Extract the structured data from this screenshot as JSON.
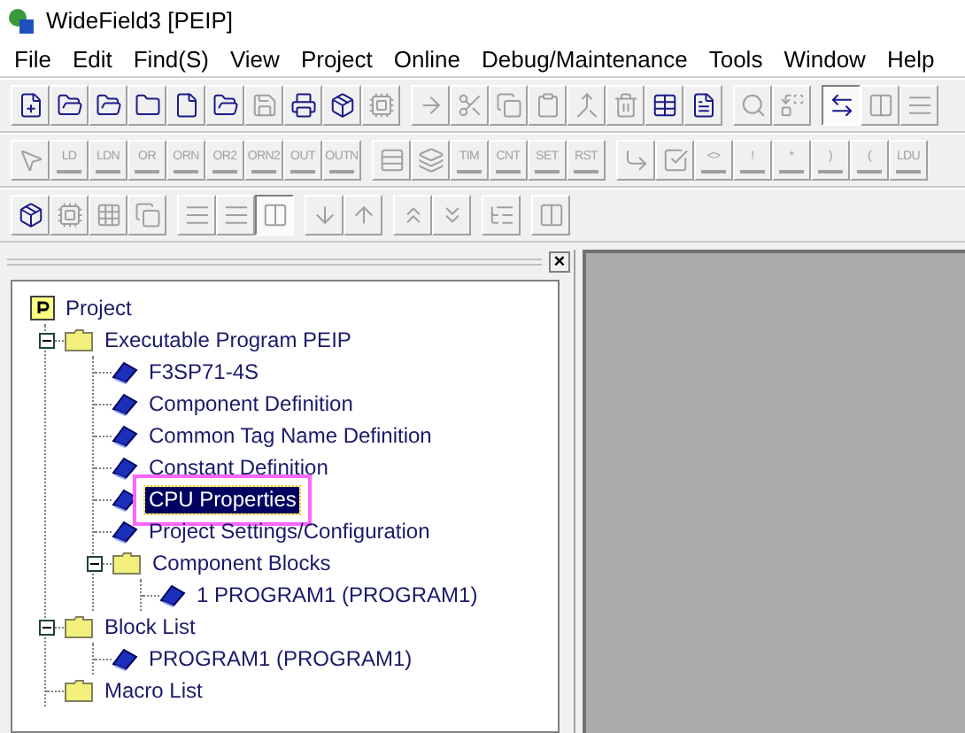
{
  "window": {
    "title": "WideField3 [PEIP]"
  },
  "menu": [
    "File",
    "Edit",
    "Find(S)",
    "View",
    "Project",
    "Online",
    "Debug/Maintenance",
    "Tools",
    "Window",
    "Help"
  ],
  "toolbars": [
    {
      "groups": [
        [
          {
            "kind": "icon",
            "disabled": false,
            "selected": false
          },
          {
            "kind": "icon",
            "disabled": false,
            "selected": false
          },
          {
            "kind": "icon",
            "disabled": false,
            "selected": false
          },
          {
            "kind": "icon",
            "disabled": false,
            "selected": false
          },
          {
            "kind": "icon",
            "disabled": false,
            "selected": false
          },
          {
            "kind": "icon",
            "disabled": false,
            "selected": false
          },
          {
            "kind": "icon",
            "disabled": true,
            "selected": false
          },
          {
            "kind": "icon",
            "disabled": false,
            "selected": false
          },
          {
            "kind": "icon",
            "disabled": false,
            "selected": false
          },
          {
            "kind": "icon",
            "disabled": true,
            "selected": false
          }
        ],
        [
          {
            "kind": "icon",
            "disabled": true,
            "selected": false
          },
          {
            "kind": "icon",
            "disabled": true,
            "selected": false
          },
          {
            "kind": "icon",
            "disabled": true,
            "selected": false
          },
          {
            "kind": "icon",
            "disabled": true,
            "selected": false
          },
          {
            "kind": "icon",
            "disabled": true,
            "selected": false
          },
          {
            "kind": "icon",
            "disabled": true,
            "selected": false
          },
          {
            "kind": "icon",
            "disabled": false,
            "selected": false
          },
          {
            "kind": "icon",
            "disabled": false,
            "selected": false
          }
        ],
        [
          {
            "kind": "icon",
            "disabled": true,
            "selected": false
          },
          {
            "kind": "icon",
            "disabled": true,
            "selected": false
          }
        ],
        [
          {
            "kind": "icon",
            "disabled": false,
            "selected": true
          },
          {
            "kind": "icon",
            "disabled": true,
            "selected": false
          },
          {
            "kind": "icon",
            "disabled": true,
            "selected": false
          }
        ]
      ]
    },
    {
      "groups": [
        [
          {
            "kind": "icon",
            "disabled": true,
            "selected": false
          },
          {
            "kind": "text",
            "label": "LD",
            "disabled": true,
            "selected": false
          },
          {
            "kind": "text",
            "label": "LDN",
            "disabled": true,
            "selected": false
          },
          {
            "kind": "text",
            "label": "OR",
            "disabled": true,
            "selected": false
          },
          {
            "kind": "text",
            "label": "ORN",
            "disabled": true,
            "selected": false
          },
          {
            "kind": "text",
            "label": "OR2",
            "disabled": true,
            "selected": false
          },
          {
            "kind": "text",
            "label": "ORN2",
            "disabled": true,
            "selected": false
          },
          {
            "kind": "text",
            "label": "OUT",
            "disabled": true,
            "selected": false
          },
          {
            "kind": "text",
            "label": "OUTN",
            "disabled": true,
            "selected": false
          }
        ],
        [
          {
            "kind": "icon",
            "disabled": true,
            "selected": false
          },
          {
            "kind": "icon",
            "disabled": true,
            "selected": false
          },
          {
            "kind": "text",
            "label": "TIM",
            "disabled": true,
            "selected": false
          },
          {
            "kind": "text",
            "label": "CNT",
            "disabled": true,
            "selected": false
          },
          {
            "kind": "text",
            "label": "SET",
            "disabled": true,
            "selected": false
          },
          {
            "kind": "text",
            "label": "RST",
            "disabled": true,
            "selected": false
          }
        ],
        [
          {
            "kind": "icon",
            "disabled": true,
            "selected": false
          },
          {
            "kind": "icon",
            "disabled": true,
            "selected": false
          },
          {
            "kind": "text",
            "label": "<>",
            "disabled": true,
            "selected": false
          },
          {
            "kind": "text",
            "label": "!",
            "disabled": true,
            "selected": false
          },
          {
            "kind": "text",
            "label": "*",
            "disabled": true,
            "selected": false
          },
          {
            "kind": "text",
            "label": ")",
            "disabled": true,
            "selected": false
          },
          {
            "kind": "text",
            "label": "(",
            "disabled": true,
            "selected": false
          },
          {
            "kind": "text",
            "label": "LDU",
            "disabled": true,
            "selected": false
          }
        ]
      ]
    },
    {
      "groups": [
        [
          {
            "kind": "icon",
            "disabled": false,
            "selected": false
          },
          {
            "kind": "icon",
            "disabled": true,
            "selected": false
          },
          {
            "kind": "icon",
            "disabled": true,
            "selected": false
          },
          {
            "kind": "icon",
            "disabled": true,
            "selected": false
          }
        ],
        [
          {
            "kind": "icon",
            "disabled": true,
            "selected": false
          },
          {
            "kind": "icon",
            "disabled": true,
            "selected": false
          },
          {
            "kind": "icon",
            "disabled": true,
            "selected": true
          }
        ],
        [
          {
            "kind": "icon",
            "disabled": true,
            "selected": false
          },
          {
            "kind": "icon",
            "disabled": true,
            "selected": false
          }
        ],
        [
          {
            "kind": "icon",
            "disabled": true,
            "selected": false
          },
          {
            "kind": "icon",
            "disabled": true,
            "selected": false
          }
        ],
        [
          {
            "kind": "icon",
            "disabled": true,
            "selected": false
          }
        ],
        [
          {
            "kind": "icon",
            "disabled": true,
            "selected": false
          }
        ]
      ]
    }
  ],
  "pane": {
    "close": "×"
  },
  "tree": [
    {
      "label": "Project",
      "kind": "project",
      "selected": false,
      "highlighted": false,
      "children": [
        {
          "label": "Executable Program PEIP",
          "kind": "folder",
          "selected": false,
          "highlighted": false,
          "expanded": true,
          "children": [
            {
              "label": "F3SP71-4S",
              "kind": "item",
              "selected": false,
              "highlighted": false
            },
            {
              "label": "Component Definition",
              "kind": "item",
              "selected": false,
              "highlighted": false
            },
            {
              "label": "Common Tag Name Definition",
              "kind": "item",
              "selected": false,
              "highlighted": false
            },
            {
              "label": "Constant Definition",
              "kind": "item",
              "selected": false,
              "highlighted": false
            },
            {
              "label": "CPU Properties",
              "kind": "item",
              "selected": true,
              "highlighted": true
            },
            {
              "label": "Project Settings/Configuration",
              "kind": "item",
              "selected": false,
              "highlighted": false
            },
            {
              "label": "Component Blocks",
              "kind": "folder",
              "selected": false,
              "highlighted": false,
              "expanded": true,
              "children": [
                {
                  "label": "1 PROGRAM1 (PROGRAM1)",
                  "kind": "item",
                  "selected": false,
                  "highlighted": false
                }
              ]
            }
          ]
        },
        {
          "label": "Block List",
          "kind": "folder",
          "selected": false,
          "highlighted": false,
          "expanded": true,
          "children": [
            {
              "label": "PROGRAM1 (PROGRAM1)",
              "kind": "item",
              "selected": false,
              "highlighted": false
            }
          ]
        },
        {
          "label": "Macro List",
          "kind": "folder",
          "selected": false,
          "highlighted": false
        }
      ]
    }
  ]
}
